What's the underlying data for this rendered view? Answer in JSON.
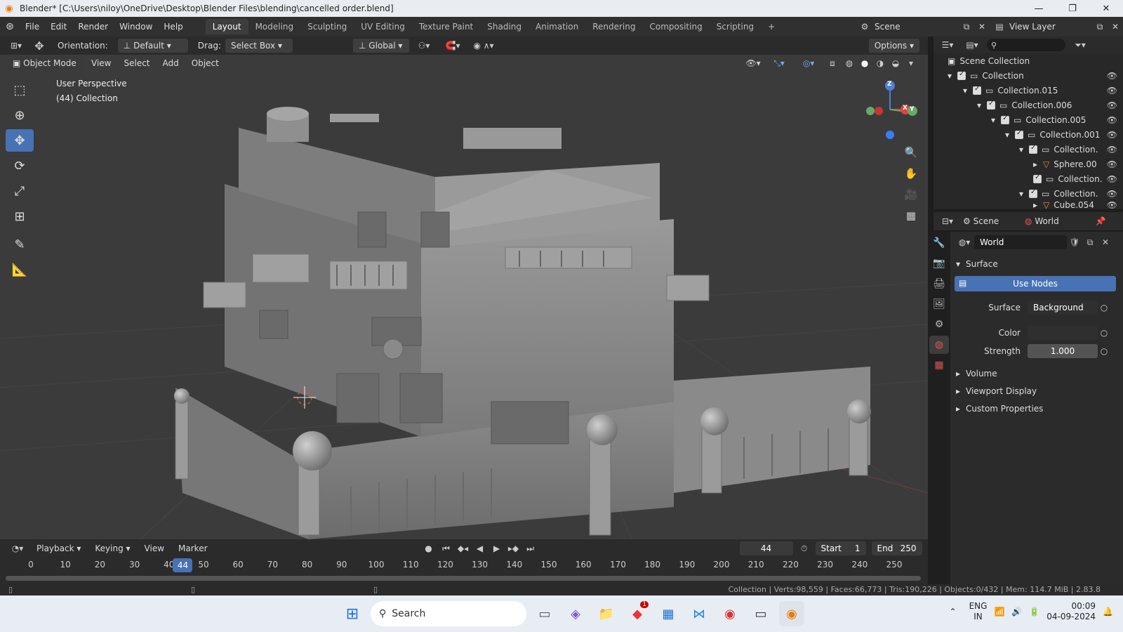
{
  "window": {
    "title": "Blender* [C:\\Users\\niloy\\OneDrive\\Desktop\\Blender Files\\blending\\cancelled order.blend]"
  },
  "menus": [
    "File",
    "Edit",
    "Render",
    "Window",
    "Help"
  ],
  "workspaces": [
    "Layout",
    "Modeling",
    "Sculpting",
    "UV Editing",
    "Texture Paint",
    "Shading",
    "Animation",
    "Rendering",
    "Compositing",
    "Scripting"
  ],
  "scene": {
    "name": "Scene",
    "view_layer": "View Layer"
  },
  "toolheader": {
    "orientation_label": "Orientation:",
    "orientation_value": "Default",
    "drag_label": "Drag:",
    "drag_value": "Select Box",
    "transform": "Global",
    "options": "Options"
  },
  "viewport_header": {
    "mode": "Object Mode",
    "view": "View",
    "select": "Select",
    "add": "Add",
    "object": "Object"
  },
  "viewport": {
    "perspective": "User Perspective",
    "collection": "(44) Collection",
    "gizmo_x": "X",
    "gizmo_y": "Y",
    "gizmo_z": "Z"
  },
  "outliner": {
    "root": "Scene Collection",
    "rows": [
      {
        "label": "Collection"
      },
      {
        "label": "Collection.015"
      },
      {
        "label": "Collection.006"
      },
      {
        "label": "Collection.005"
      },
      {
        "label": "Collection.001"
      },
      {
        "label": "Collection."
      },
      {
        "label": "Sphere.00"
      },
      {
        "label": "Collection."
      },
      {
        "label": "Collection."
      },
      {
        "label": "Cube.054"
      }
    ]
  },
  "properties": {
    "tab_scene": "Scene",
    "tab_world": "World",
    "world_name": "World",
    "surface_header": "Surface",
    "use_nodes": "Use Nodes",
    "surface_label": "Surface",
    "surface_value": "Background",
    "color_label": "Color",
    "strength_label": "Strength",
    "strength_value": "1.000",
    "volume": "Volume",
    "viewport_display": "Viewport Display",
    "custom_properties": "Custom Properties"
  },
  "timeline": {
    "playback": "Playback",
    "keying": "Keying",
    "view": "View",
    "marker": "Marker",
    "current_frame": "44",
    "start_label": "Start",
    "start_value": "1",
    "end_label": "End",
    "end_value": "250",
    "ticks": [
      "0",
      "10",
      "20",
      "30",
      "40",
      "50",
      "60",
      "70",
      "80",
      "90",
      "100",
      "110",
      "120",
      "130",
      "140",
      "150",
      "160",
      "170",
      "180",
      "190",
      "200",
      "210",
      "220",
      "230",
      "240",
      "250"
    ],
    "playhead": "44"
  },
  "statusbar": {
    "text": "Collection | Verts:98,559 | Faces:66,773 | Tris:190,226 | Objects:0/432 | Mem: 114.7 MiB | 2.83.8"
  },
  "taskbar": {
    "search": "Search",
    "lang1": "ENG",
    "lang2": "IN",
    "time": "00:09",
    "date": "04-09-2024",
    "badge": "1"
  },
  "colors": {
    "accent": "#4772b3",
    "header": "#303030",
    "viewport_bg": "#3b3b3b"
  }
}
